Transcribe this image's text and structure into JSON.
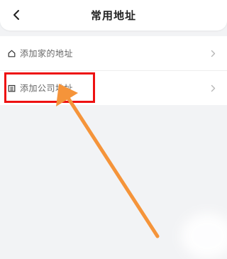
{
  "header": {
    "title": "常用地址",
    "back_icon": "chevron-left-icon"
  },
  "addresses": [
    {
      "label": "添加家的地址",
      "icon": "home-icon",
      "chevron": "chevron-right-icon"
    },
    {
      "label": "添加公司地址",
      "icon": "building-icon",
      "chevron": "chevron-right-icon"
    }
  ],
  "annotation": {
    "box_color": "#ee1111",
    "arrow_color": "#f5943a"
  }
}
